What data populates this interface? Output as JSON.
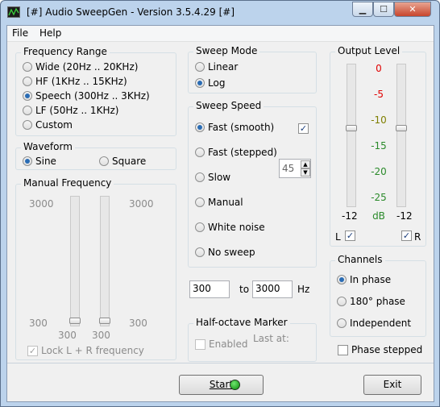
{
  "window": {
    "title": "[#] Audio SweepGen - Version 3.5.4.29 [#]"
  },
  "menu": {
    "file": "File",
    "help": "Help"
  },
  "frequency_range": {
    "title": "Frequency Range",
    "options": [
      {
        "label": "Wide  (20Hz .. 20KHz)",
        "selected": false
      },
      {
        "label": "HF  (1KHz .. 15KHz)",
        "selected": false
      },
      {
        "label": "Speech  (300Hz .. 3KHz)",
        "selected": true
      },
      {
        "label": "LF  (50Hz .. 1KHz)",
        "selected": false
      },
      {
        "label": "Custom",
        "selected": false
      }
    ]
  },
  "waveform": {
    "title": "Waveform",
    "sine": "Sine",
    "sine_selected": true,
    "square": "Square",
    "square_selected": false
  },
  "manual_frequency": {
    "title": "Manual Frequency",
    "left_top": "3000",
    "left_bottom": "300",
    "right_top": "3000",
    "right_bottom": "300",
    "left_slider_value": "300",
    "right_slider_value": "300",
    "lock_label": "Lock L + R frequency",
    "lock_checked": true
  },
  "sweep_mode": {
    "title": "Sweep Mode",
    "linear": "Linear",
    "linear_selected": false,
    "log": "Log",
    "log_selected": true
  },
  "sweep_speed": {
    "title": "Sweep Speed",
    "options": [
      {
        "label": "Fast (smooth)",
        "selected": true
      },
      {
        "label": "Fast (stepped)",
        "selected": false
      },
      {
        "label": "Slow",
        "selected": false
      },
      {
        "label": "Manual",
        "selected": false
      },
      {
        "label": "White noise",
        "selected": false
      },
      {
        "label": "No sweep",
        "selected": false
      }
    ],
    "fast_smooth_checked": true,
    "step_value": "45"
  },
  "range": {
    "from": "300",
    "to_label": "to",
    "to": "3000",
    "unit": "Hz"
  },
  "half_octave": {
    "title": "Half-octave Marker",
    "enabled_label": "Enabled",
    "enabled": false,
    "last_at": "Last at:"
  },
  "output_level": {
    "title": "Output Level",
    "scale": [
      "0",
      "-5",
      "-10",
      "-15",
      "-20",
      "-25"
    ],
    "scale_colors": [
      "#e00000",
      "#e00000",
      "#7f7f00",
      "#2a8a2a",
      "#2a8a2a",
      "#2a8a2a"
    ],
    "left_value": "-12",
    "right_value": "-12",
    "unit": "dB",
    "left_label": "L",
    "left_checked": true,
    "right_label": "R",
    "right_checked": true
  },
  "channels": {
    "title": "Channels",
    "options": [
      {
        "label": "In phase",
        "selected": true
      },
      {
        "label": "180° phase",
        "selected": false
      },
      {
        "label": "Independent",
        "selected": false
      }
    ]
  },
  "phase_stepped": {
    "label": "Phase stepped",
    "checked": false
  },
  "buttons": {
    "start": "Start",
    "exit": "Exit"
  }
}
